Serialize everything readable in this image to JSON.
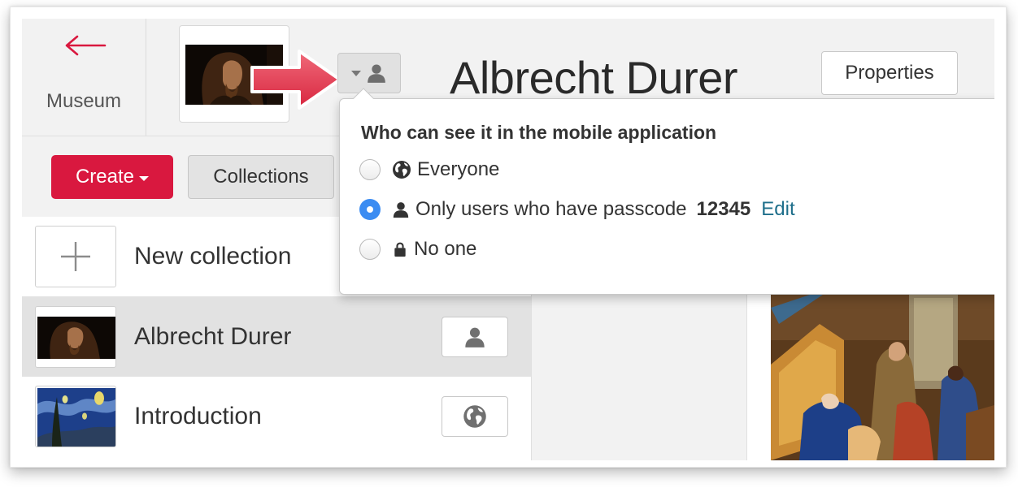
{
  "header": {
    "back_label": "Museum",
    "title": "Albrecht Durer",
    "properties_label": "Properties",
    "visibility_icon": "user-icon"
  },
  "toolbar": {
    "create_label": "Create",
    "collections_label": "Collections"
  },
  "collections": [
    {
      "label": "New collection",
      "icon": "plus-icon"
    },
    {
      "label": "Albrecht Durer",
      "visibility_icon": "user-icon",
      "selected": true
    },
    {
      "label": "Introduction",
      "visibility_icon": "globe-icon",
      "selected": false
    }
  ],
  "visibility_popover": {
    "title": "Who can see it in the mobile application",
    "options": [
      {
        "label": "Everyone",
        "icon": "globe-icon",
        "checked": false
      },
      {
        "label": "Only users who have passcode",
        "icon": "user-icon",
        "checked": true,
        "passcode": "12345",
        "edit_label": "Edit"
      },
      {
        "label": "No one",
        "icon": "lock-icon",
        "checked": false
      }
    ]
  },
  "colors": {
    "accent": "#d9183f",
    "radio_selected": "#3b8cf2",
    "link": "#1f6f8b"
  }
}
